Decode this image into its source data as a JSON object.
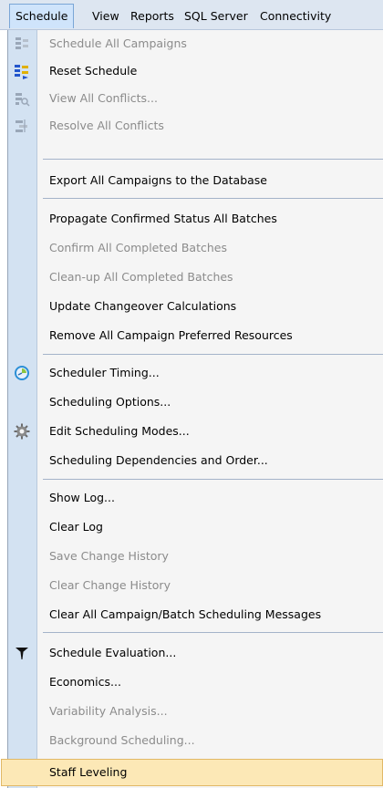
{
  "menubar": {
    "items": [
      {
        "label": "Schedule"
      },
      {
        "label": "View"
      },
      {
        "label": "Reports"
      },
      {
        "label": "SQL Server"
      },
      {
        "label": "Connectivity"
      }
    ]
  },
  "menu": {
    "items": [
      {
        "label": "Schedule All Campaigns",
        "enabled": false,
        "icon": "schedule-all-icon"
      },
      {
        "label": "Reset Schedule",
        "enabled": true,
        "icon": "reset-schedule-icon"
      },
      {
        "label": "View All Conflicts...",
        "enabled": false,
        "icon": "view-conflicts-icon"
      },
      {
        "label": "Resolve All Conflicts",
        "enabled": false,
        "icon": "resolve-conflicts-icon"
      },
      {
        "label": "Export All Campaigns to the Database",
        "enabled": true
      },
      {
        "label": "Propagate Confirmed Status All Batches",
        "enabled": true
      },
      {
        "label": "Confirm All Completed Batches",
        "enabled": false
      },
      {
        "label": "Clean-up All Completed Batches",
        "enabled": false
      },
      {
        "label": "Update Changeover Calculations",
        "enabled": true
      },
      {
        "label": "Remove All Campaign Preferred Resources",
        "enabled": true
      },
      {
        "label": "Scheduler Timing...",
        "enabled": true,
        "icon": "timer-icon"
      },
      {
        "label": "Scheduling Options...",
        "enabled": true
      },
      {
        "label": "Edit Scheduling Modes...",
        "enabled": true,
        "icon": "gear-icon"
      },
      {
        "label": "Scheduling Dependencies and Order...",
        "enabled": true
      },
      {
        "label": "Show Log...",
        "enabled": true
      },
      {
        "label": "Clear Log",
        "enabled": true
      },
      {
        "label": "Save Change History",
        "enabled": false
      },
      {
        "label": "Clear Change History",
        "enabled": false
      },
      {
        "label": "Clear All Campaign/Batch Scheduling Messages",
        "enabled": true
      },
      {
        "label": "Schedule Evaluation...",
        "enabled": true,
        "icon": "funnel-icon"
      },
      {
        "label": "Economics...",
        "enabled": true
      },
      {
        "label": "Variability Analysis...",
        "enabled": false
      },
      {
        "label": "Background Scheduling...",
        "enabled": false
      },
      {
        "label": "Staff Leveling",
        "enabled": true,
        "highlighted": true
      }
    ]
  },
  "colors": {
    "menubar_bg": "#dde6f1",
    "gutter_bg": "#d3e2f2",
    "disabled_text": "#8b8b8b",
    "highlight_bg": "#fce8b6",
    "highlight_border": "#e1b866"
  }
}
